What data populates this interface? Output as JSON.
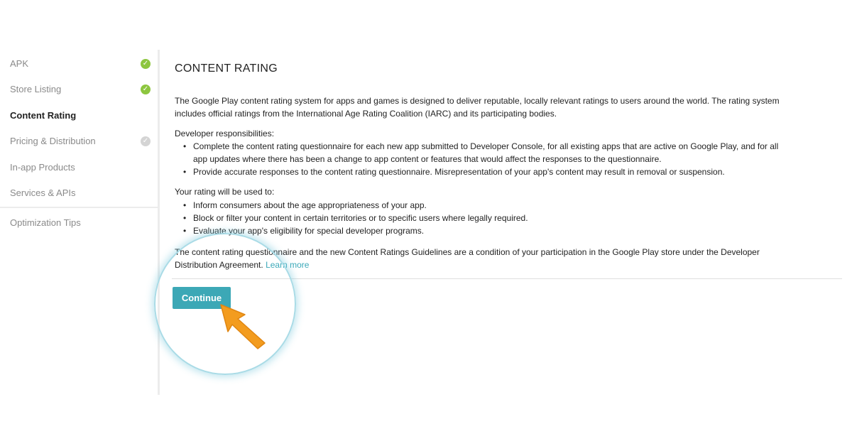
{
  "sidebar": {
    "items": [
      {
        "label": "APK",
        "status": "complete"
      },
      {
        "label": "Store Listing",
        "status": "complete"
      },
      {
        "label": "Content Rating",
        "status": "active"
      },
      {
        "label": "Pricing & Distribution",
        "status": "incomplete"
      },
      {
        "label": "In-app Products",
        "status": "none"
      },
      {
        "label": "Services & APIs",
        "status": "none"
      }
    ],
    "secondary": [
      {
        "label": "Optimization Tips"
      }
    ]
  },
  "main": {
    "title": "CONTENT RATING",
    "intro_line1": "The Google Play content rating system for apps and games is designed to deliver reputable, locally relevant ratings to users around the world. The rating system",
    "intro_line2": "includes official ratings from the International Age Rating Coalition (IARC) and its participating bodies.",
    "responsibilities_label": "Developer responsibilities:",
    "responsibilities": [
      {
        "line1": "Complete the content rating questionnaire for each new app submitted to Developer Console, for all existing apps that are active on Google Play, and for all",
        "line2": "app updates where there has been a change to app content or features that would affect the responses to the questionnaire."
      },
      {
        "line1": "Provide accurate responses to the content rating questionnaire. Misrepresentation of your app's content may result in removal or suspension.",
        "line2": ""
      }
    ],
    "usage_label": "Your rating will be used to:",
    "usage": [
      "Inform consumers about the age appropriateness of your app.",
      "Block or filter your content in certain territories or to specific users where legally required.",
      "Evaluate your app's eligibility for special developer programs."
    ],
    "closing_line1": "The content rating questionnaire and the new Content Ratings Guidelines are a condition of your participation in the Google Play store under the Developer",
    "closing_line2": "Distribution Agreement.",
    "learn_more": "Learn more",
    "continue_label": "Continue"
  },
  "colors": {
    "accent": "#3ca8b6",
    "check_complete": "#8dc63f",
    "check_incomplete": "#d4d4d4",
    "pointer": "#f39c1f"
  },
  "icons": {
    "complete": "check-circle-icon",
    "pointer": "pointer-arrow-icon"
  }
}
